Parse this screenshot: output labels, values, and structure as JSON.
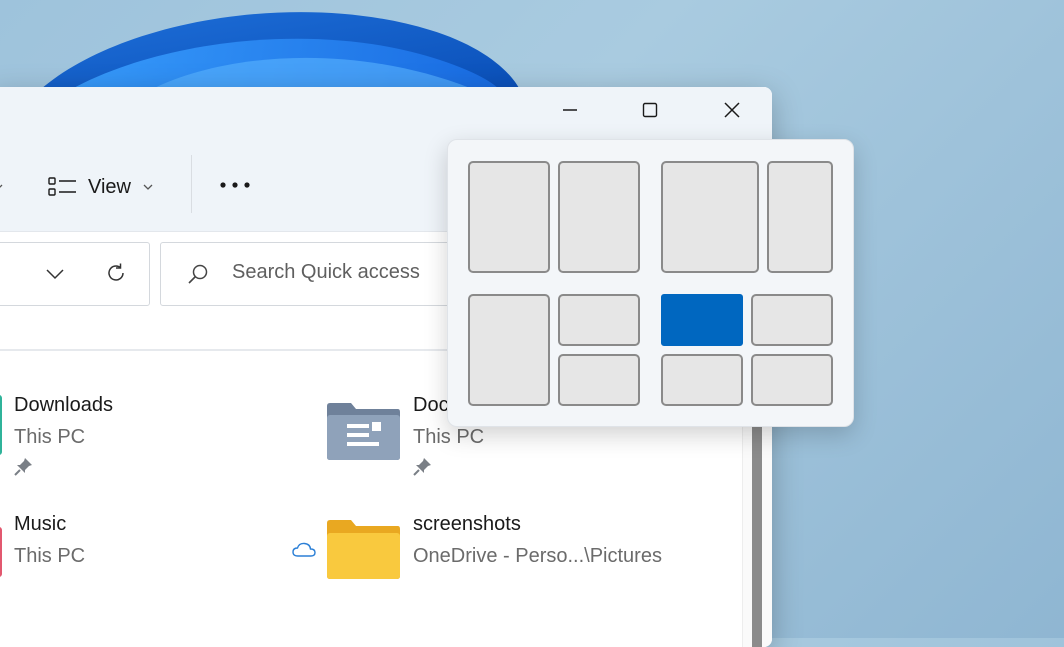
{
  "window": {
    "minimize_icon": "minimize-icon",
    "maximize_icon": "maximize-icon",
    "close_icon": "close-icon"
  },
  "toolbar": {
    "view_label": "View",
    "view_icon": "view-list-icon",
    "more_icon": "more-icon"
  },
  "address": {
    "dropdown_icon": "chevron-down-icon",
    "refresh_icon": "refresh-icon"
  },
  "search": {
    "placeholder": "Search Quick access",
    "icon": "search-icon"
  },
  "quick_access": [
    {
      "name": "Downloads",
      "location": "This PC",
      "pinned": true
    },
    {
      "name": "Doc",
      "location": "This PC",
      "pinned": true
    },
    {
      "name": "Music",
      "location": "This PC",
      "pinned": false
    },
    {
      "name": "screenshots",
      "location": "OneDrive - Perso...\\Pictures",
      "pinned": false,
      "cloud": true
    }
  ],
  "snap_layouts": {
    "active_zone": "layout-4-top-left",
    "accent_color": "#0067c0"
  },
  "colors": {
    "window_bg": "#ffffff",
    "chrome_bg": "#eff4f9",
    "folder_yellow": "#f9c93e",
    "documents_folder": "#7b8da6"
  }
}
